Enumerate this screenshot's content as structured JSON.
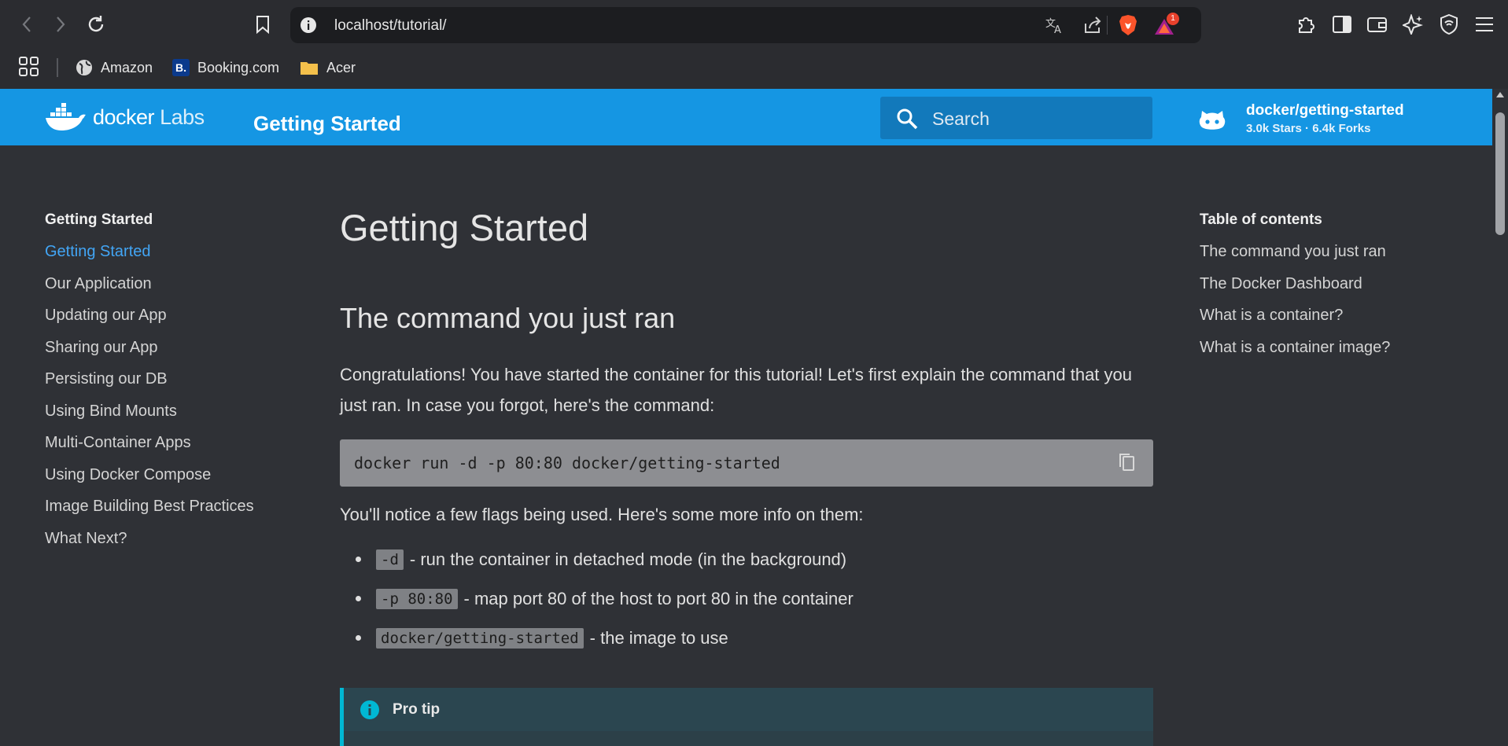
{
  "browser": {
    "url": "localhost/tutorial/",
    "badge_count": "1",
    "bookmarks": [
      {
        "label": "Amazon",
        "icon": "globe-icon"
      },
      {
        "label": "Booking.com",
        "icon": "booking-icon",
        "icon_text": "B."
      },
      {
        "label": "Acer",
        "icon": "folder-icon"
      }
    ]
  },
  "header": {
    "logo_docker": "docker",
    "logo_labs": "Labs",
    "site_title": "Getting Started",
    "search_placeholder": "Search",
    "repo_name": "docker/getting-started",
    "repo_stats": "3.0k Stars · 6.4k Forks",
    "brand_color": "#1596e3"
  },
  "nav": {
    "heading": "Getting Started",
    "items": [
      {
        "label": "Getting Started",
        "current": true
      },
      {
        "label": "Our Application"
      },
      {
        "label": "Updating our App"
      },
      {
        "label": "Sharing our App"
      },
      {
        "label": "Persisting our DB"
      },
      {
        "label": "Using Bind Mounts"
      },
      {
        "label": "Multi-Container Apps"
      },
      {
        "label": "Using Docker Compose"
      },
      {
        "label": "Image Building Best Practices"
      },
      {
        "label": "What Next?"
      }
    ]
  },
  "content": {
    "title": "Getting Started",
    "section_heading": "The command you just ran",
    "intro": "Congratulations! You have started the container for this tutorial! Let's first explain the command that you just ran. In case you forgot, here's the command:",
    "command": "docker run -d -p 80:80 docker/getting-started",
    "flags_intro": "You'll notice a few flags being used. Here's some more info on them:",
    "flags": [
      {
        "code": "-d",
        "desc": "- run the container in detached mode (in the background)"
      },
      {
        "code": "-p 80:80",
        "desc": "- map port 80 of the host to port 80 in the container"
      },
      {
        "code": "docker/getting-started",
        "desc": "- the image to use"
      }
    ],
    "tip_title": "Pro tip"
  },
  "toc": {
    "heading": "Table of contents",
    "items": [
      "The command you just ran",
      "The Docker Dashboard",
      "What is a container?",
      "What is a container image?"
    ]
  }
}
